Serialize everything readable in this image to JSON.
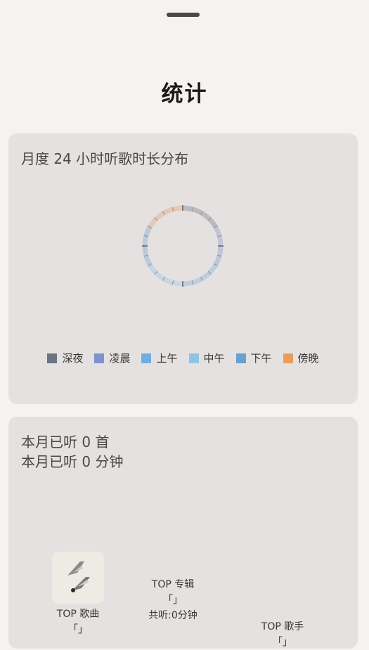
{
  "page": {
    "title": "统计"
  },
  "distribution_card": {
    "title": "月度 24 小时听歌时长分布",
    "legend": [
      {
        "label": "深夜",
        "color": "#6b7480"
      },
      {
        "label": "凌晨",
        "color": "#7f93cf"
      },
      {
        "label": "上午",
        "color": "#6daee0"
      },
      {
        "label": "中午",
        "color": "#8ec4e4"
      },
      {
        "label": "下午",
        "color": "#66a1cf"
      },
      {
        "label": "傍晚",
        "color": "#e89d5e"
      }
    ]
  },
  "summary_card": {
    "songs_line": "本月已听 0 首",
    "minutes_line": "本月已听 0 分钟",
    "top_song": {
      "label": "TOP 歌曲",
      "value": "「」"
    },
    "top_album": {
      "label": "TOP 专辑",
      "value": "「」",
      "listen_time": "共听:0分钟"
    },
    "top_artist": {
      "label": "TOP 歌手",
      "value": "「」"
    }
  }
}
